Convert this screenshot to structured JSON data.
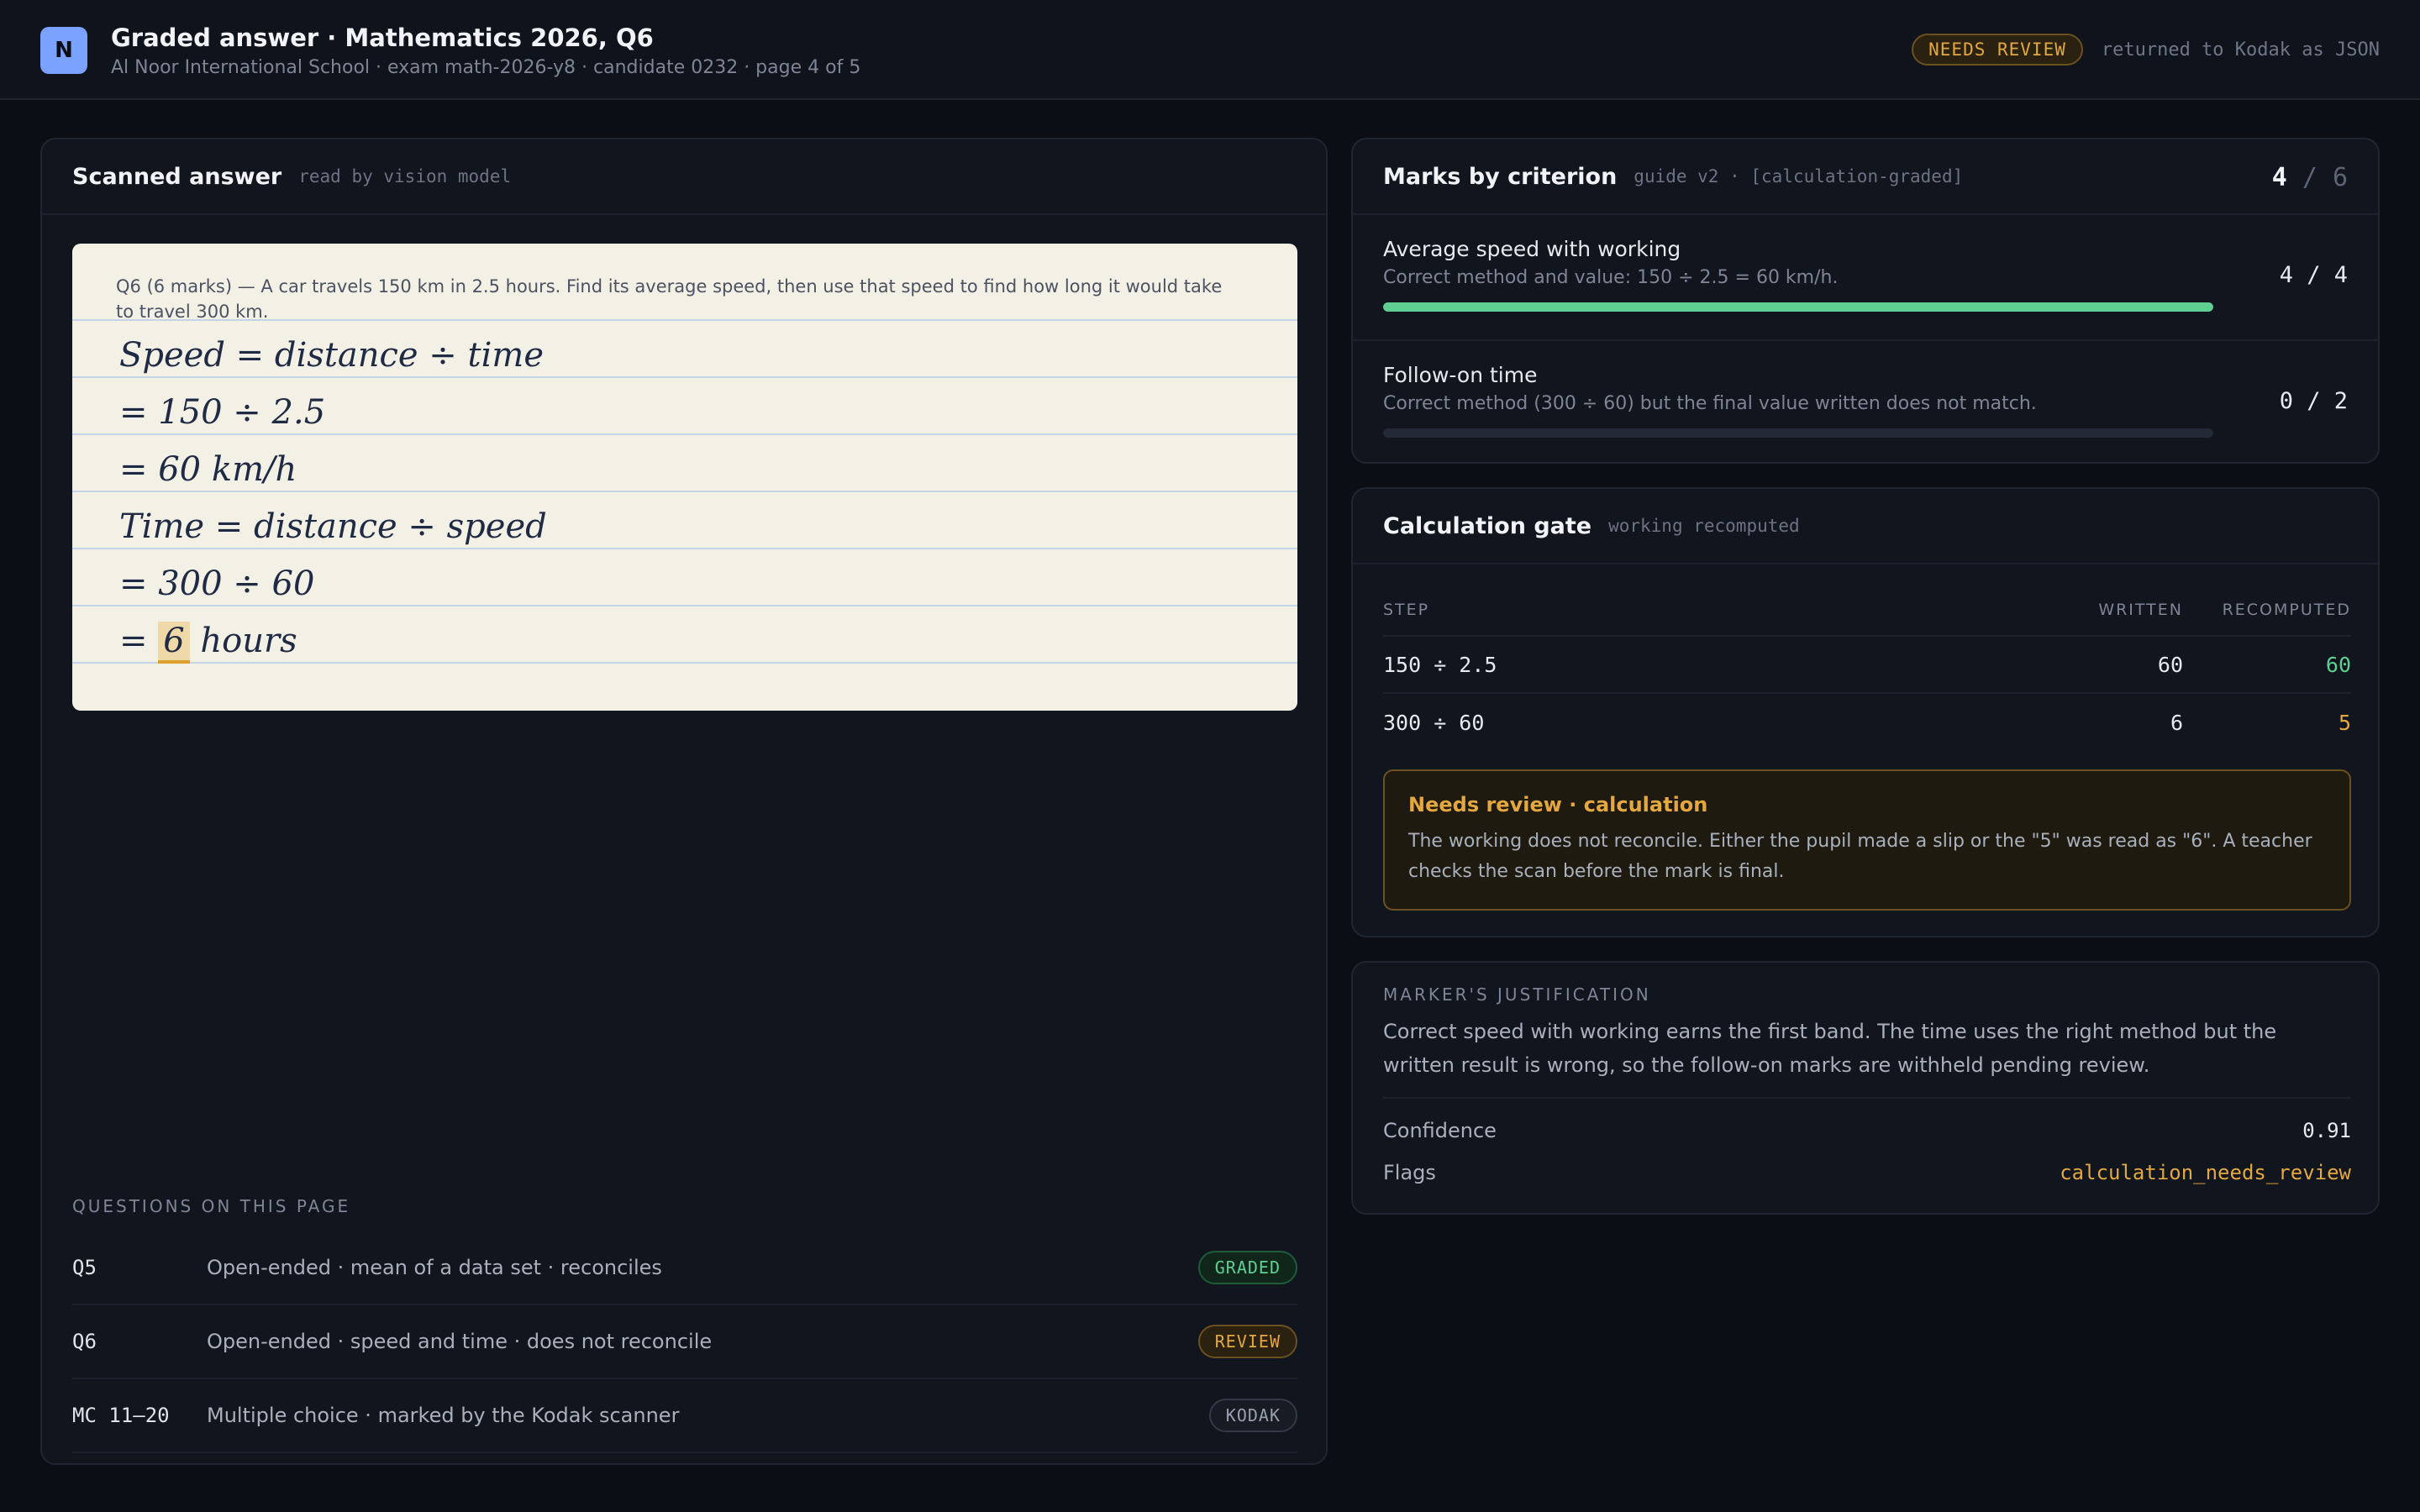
{
  "header": {
    "logo_letter": "N",
    "title": "Graded answer · Mathematics 2026, Q6",
    "subtitle": "Al Noor International School · exam math-2026-y8 · candidate 0232 · page 4 of 5",
    "status_badge": "NEEDS REVIEW",
    "return_note": "returned to Kodak as JSON"
  },
  "scan": {
    "title": "Scanned answer",
    "tag": "read by vision model",
    "question": "Q6 (6 marks) — A car travels 150 km in 2.5 hours. Find its average speed, then use that speed to find how long it would take to travel 300 km.",
    "lines": [
      "Speed = distance ÷ time",
      "= 150 ÷ 2.5",
      "= 60 km/h",
      "Time = distance ÷ speed",
      "= 300 ÷ 60"
    ],
    "last_line": {
      "prefix": "= ",
      "highlight": "6",
      "suffix": " hours"
    }
  },
  "questions": {
    "label": "QUESTIONS ON THIS PAGE",
    "rows": [
      {
        "id": "Q5",
        "desc": "Open-ended · mean of a data set · reconciles",
        "status": "GRADED"
      },
      {
        "id": "Q6",
        "desc": "Open-ended · speed and time · does not reconcile",
        "status": "REVIEW"
      },
      {
        "id": "MC 11–20",
        "desc": "Multiple choice · marked by the Kodak scanner",
        "status": "KODAK"
      }
    ]
  },
  "marks": {
    "title": "Marks by criterion",
    "tag": "guide v2 · [calculation-graded]",
    "total_awarded": "4",
    "total_sep": "/",
    "total_possible": "6",
    "criteria": [
      {
        "name": "Average speed with working",
        "desc": "Correct method and value: 150 ÷ 2.5 = 60 km/h.",
        "score": "4 / 4",
        "fraction": 1.0
      },
      {
        "name": "Follow-on time",
        "desc": "Correct method (300 ÷ 60) but the final value written does not match.",
        "score": "0 / 2",
        "fraction": 0.0
      }
    ]
  },
  "gate": {
    "title": "Calculation gate",
    "tag": "working recomputed",
    "headers": {
      "step": "STEP",
      "written": "WRITTEN",
      "recomputed": "RECOMPUTED"
    },
    "rows": [
      {
        "step": "150 ÷ 2.5",
        "written": "60",
        "recomputed": "60",
        "match": true
      },
      {
        "step": "300 ÷ 60",
        "written": "6",
        "recomputed": "5",
        "match": false
      }
    ],
    "warning": {
      "title": "Needs review · calculation",
      "body": "The working does not reconcile. Either the pupil made a slip or the \"5\" was read as \"6\". A teacher checks the scan before the mark is final."
    }
  },
  "justification": {
    "label": "MARKER'S JUSTIFICATION",
    "text": "Correct speed with working earns the first band. The time uses the right method but the written result is wrong, so the follow-on marks are withheld pending review.",
    "confidence_label": "Confidence",
    "confidence": "0.91",
    "flags_label": "Flags",
    "flags": "calculation_needs_review"
  },
  "colors": {
    "accent": "#7aa2ff",
    "success": "#5fd092",
    "warning": "#e3a83f",
    "background": "#0b0e14"
  }
}
